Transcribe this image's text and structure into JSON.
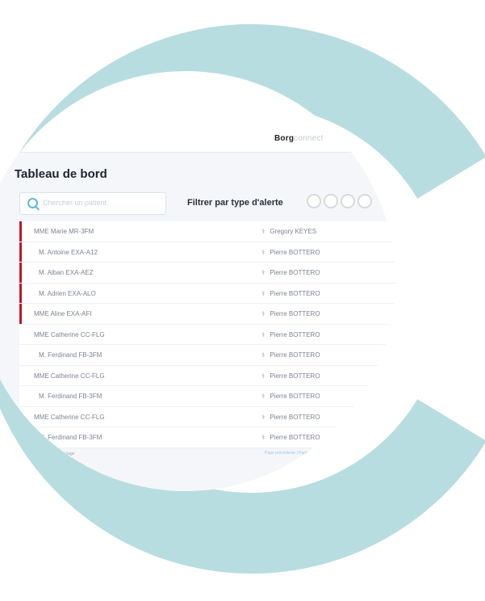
{
  "brand": {
    "bold": "Borg",
    "light": "connect"
  },
  "page": {
    "title": "Tableau de bord"
  },
  "search": {
    "placeholder": "Chercher un patient"
  },
  "filter": {
    "label": "Filtrer par type d'alerte"
  },
  "rows": [
    {
      "name": "MME  Marie MR-3FM",
      "doctor": "Gregory KEYES",
      "alert": true,
      "badges": [
        "purple",
        "grey"
      ]
    },
    {
      "name": "M.  Antoine EXA-A12",
      "doctor": "Pierre BOTTERO",
      "alert": true,
      "badges": [
        "purple",
        "grey"
      ]
    },
    {
      "name": "M.  Alban EXA-AEZ",
      "doctor": "Pierre BOTTERO",
      "alert": true,
      "badges": [
        "purple",
        "grey"
      ]
    },
    {
      "name": "M.  Adrien EXA-ALO",
      "doctor": "Pierre BOTTERO",
      "alert": true,
      "badges": [
        "purple",
        "blue"
      ]
    },
    {
      "name": "MME  Aline EXA-AFI",
      "doctor": "Pierre BOTTERO",
      "alert": true,
      "badges": [
        "purple",
        "grey"
      ]
    },
    {
      "name": "MME  Catherine CC-FLG",
      "doctor": "Pierre BOTTERO",
      "alert": false,
      "badges": [
        "outline",
        "outline"
      ]
    },
    {
      "name": "M.  Ferdinand FB-3FM",
      "doctor": "Pierre BOTTERO",
      "alert": false,
      "badges": [
        "outline",
        "outline"
      ]
    },
    {
      "name": "MME  Catherine CC-FLG",
      "doctor": "Pierre BOTTERO",
      "alert": false,
      "badges": [
        "outline",
        "outline"
      ]
    },
    {
      "name": "M.  Ferdinand FB-3FM",
      "doctor": "Pierre BOTTERO",
      "alert": false,
      "badges": [
        "outline",
        "outline"
      ]
    },
    {
      "name": "MME  Catherine CC-FLG",
      "doctor": "Pierre BOTTERO",
      "alert": false,
      "badges": [
        "outline"
      ]
    },
    {
      "name": "M.  Ferdinand FB-3FM",
      "doctor": "Pierre BOTTERO",
      "alert": false,
      "badges": []
    }
  ],
  "footer": {
    "show_prefix": "Voir",
    "page_size": "10",
    "show_suffix": "Élément par page",
    "pagination": "Page précédente  |  Page suivante"
  },
  "colors": {
    "ring": "#b8dde0",
    "alert": "#c0162e",
    "badge_purple": "#3b2a8c",
    "badge_blue": "#2b8fd6"
  }
}
